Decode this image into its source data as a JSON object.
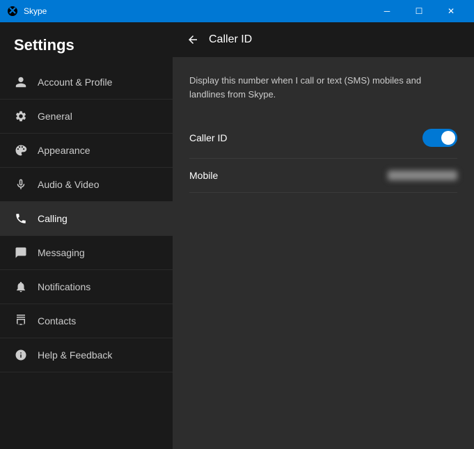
{
  "titlebar": {
    "icon": "S",
    "title": "Skype",
    "minimize_label": "─",
    "maximize_label": "☐",
    "close_label": "✕"
  },
  "sidebar": {
    "header": "Settings",
    "items": [
      {
        "id": "account",
        "label": "Account & Profile",
        "icon": "person"
      },
      {
        "id": "general",
        "label": "General",
        "icon": "gear"
      },
      {
        "id": "appearance",
        "label": "Appearance",
        "icon": "appearance"
      },
      {
        "id": "audio-video",
        "label": "Audio & Video",
        "icon": "microphone"
      },
      {
        "id": "calling",
        "label": "Calling",
        "icon": "phone",
        "active": true
      },
      {
        "id": "messaging",
        "label": "Messaging",
        "icon": "chat"
      },
      {
        "id": "notifications",
        "label": "Notifications",
        "icon": "bell"
      },
      {
        "id": "contacts",
        "label": "Contacts",
        "icon": "contacts"
      },
      {
        "id": "help",
        "label": "Help & Feedback",
        "icon": "info"
      }
    ]
  },
  "content": {
    "back_label": "←",
    "title": "Caller ID",
    "description": "Display this number when I call or text (SMS) mobiles and landlines from Skype.",
    "settings": [
      {
        "id": "caller-id",
        "label": "Caller ID",
        "type": "toggle",
        "value": true
      },
      {
        "id": "mobile",
        "label": "Mobile",
        "type": "blurred-text",
        "value": "••••••••••"
      }
    ]
  }
}
